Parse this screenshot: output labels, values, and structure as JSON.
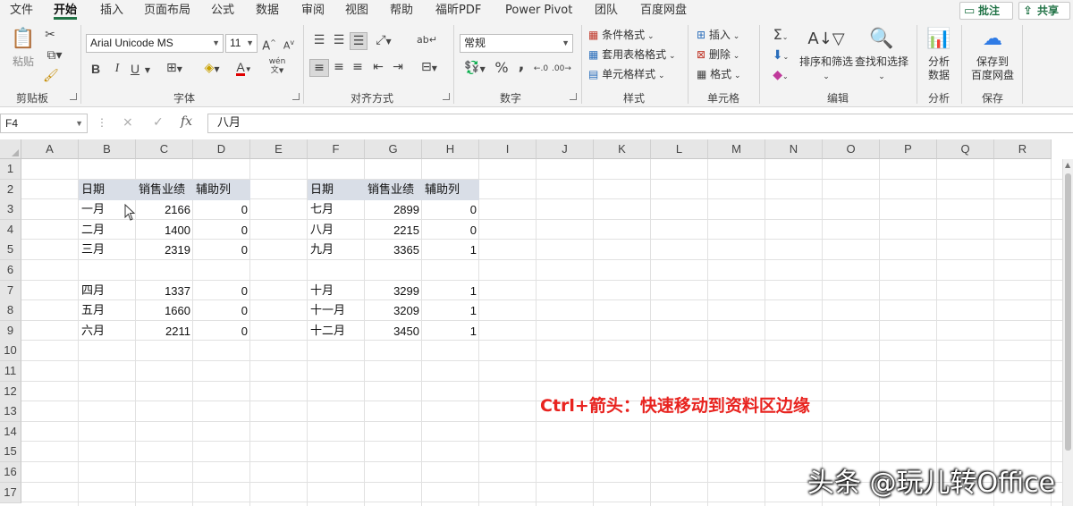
{
  "menu": {
    "tabs": [
      "文件",
      "开始",
      "插入",
      "页面布局",
      "公式",
      "数据",
      "审阅",
      "视图",
      "帮助",
      "福昕PDF",
      "Power Pivot",
      "团队",
      "百度网盘"
    ],
    "active_tab": "开始",
    "comments_label": "批注",
    "share_label": "共享"
  },
  "ribbon": {
    "clipboard": {
      "paste_label": "粘贴",
      "group_label": "剪贴板"
    },
    "font": {
      "font_name": "Arial Unicode MS",
      "font_size": "11",
      "group_label": "字体",
      "bold": "B",
      "italic": "I",
      "underline": "U",
      "font_color": "A",
      "phonetic": "wén"
    },
    "alignment": {
      "group_label": "对齐方式"
    },
    "number": {
      "format": "常规",
      "percent": "%",
      "comma": ",",
      "group_label": "数字"
    },
    "styles": {
      "conditional_format": "条件格式",
      "table_format": "套用表格格式",
      "cell_styles": "单元格样式",
      "group_label": "样式"
    },
    "cells": {
      "insert": "插入",
      "delete": "删除",
      "format": "格式",
      "group_label": "单元格"
    },
    "editing": {
      "sort_filter": "排序和筛选",
      "find_select": "查找和选择",
      "group_label": "编辑"
    },
    "analysis": {
      "analyze_data_line1": "分析",
      "analyze_data_line2": "数据",
      "group_label": "分析"
    },
    "save": {
      "save_to_line1": "保存到",
      "save_to_line2": "百度网盘",
      "group_label": "保存"
    }
  },
  "formula_bar": {
    "name_box": "F4",
    "cancel": "×",
    "enter": "✓",
    "fx": "fx",
    "content": "八月"
  },
  "grid": {
    "columns": [
      "A",
      "B",
      "C",
      "D",
      "E",
      "F",
      "G",
      "H",
      "I",
      "J",
      "K",
      "L",
      "M",
      "N",
      "O",
      "P",
      "Q",
      "R"
    ],
    "rows": [
      "1",
      "2",
      "3",
      "4",
      "5",
      "6",
      "7",
      "8",
      "9",
      "10",
      "11",
      "12",
      "13",
      "14",
      "15",
      "16",
      "17"
    ]
  },
  "table_left": {
    "headers": [
      "日期",
      "销售业绩",
      "辅助列"
    ],
    "rows": [
      [
        "一月",
        "2166",
        "0"
      ],
      [
        "二月",
        "1400",
        "0"
      ],
      [
        "三月",
        "2319",
        "0"
      ],
      [
        "",
        "",
        ""
      ],
      [
        "四月",
        "1337",
        "0"
      ],
      [
        "五月",
        "1660",
        "0"
      ],
      [
        "六月",
        "2211",
        "0"
      ]
    ]
  },
  "table_right": {
    "headers": [
      "日期",
      "销售业绩",
      "辅助列"
    ],
    "rows": [
      [
        "七月",
        "2899",
        "0"
      ],
      [
        "八月",
        "2215",
        "0"
      ],
      [
        "九月",
        "3365",
        "1"
      ],
      [
        "",
        "",
        ""
      ],
      [
        "十月",
        "3299",
        "1"
      ],
      [
        "十一月",
        "3209",
        "1"
      ],
      [
        "十二月",
        "3450",
        "1"
      ]
    ]
  },
  "annotation": "Ctrl+箭头：快速移动到资料区边缘",
  "watermark": "头条 @玩儿转Office",
  "colors": {
    "accent": "#217346",
    "annotation": "#e8231f",
    "header_band": "#d9dee7"
  }
}
